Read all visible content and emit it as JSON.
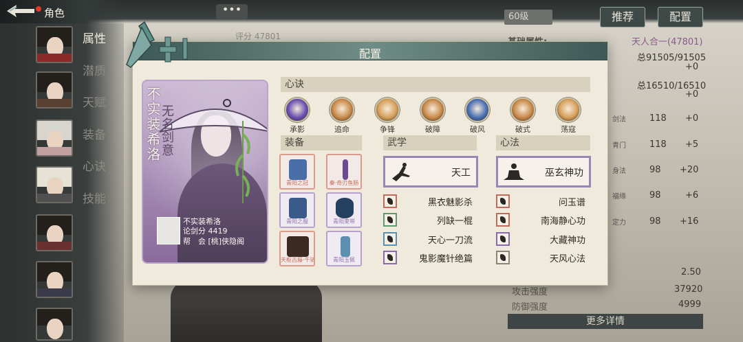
{
  "header": {
    "title": "角色"
  },
  "side_nav": [
    "属性",
    "潜质",
    "天赋",
    "装备",
    "心诀",
    "技能"
  ],
  "top": {
    "level": "60级",
    "score": "评分 47801",
    "recommend_label": "推荐",
    "config_label": "配置",
    "chat_label": "•••"
  },
  "right_panel": {
    "basic_attr_label": "基础属性:",
    "realm": "天人合一(47801)",
    "total1": "总91505/91505",
    "plus1": "+0",
    "total2": "总16510/16510",
    "plus2": "+0",
    "stats": [
      {
        "name": "剑法",
        "value": "118",
        "bonus": "+0"
      },
      {
        "name": "青门",
        "value": "118",
        "bonus": "+5"
      },
      {
        "name": "身法",
        "value": "98",
        "bonus": "+20"
      },
      {
        "name": "福缘",
        "value": "98",
        "bonus": "+6"
      },
      {
        "name": "定力",
        "value": "98",
        "bonus": "+16"
      }
    ],
    "crit_value": "2.50",
    "attack_label": "攻击强度",
    "attack_value": "37920",
    "defense_label": "防御强度",
    "defense_value": "4999",
    "more_label": "更多详情"
  },
  "modal": {
    "title": "配置",
    "character": {
      "name": "不实装希洛",
      "title": "无名剑意",
      "info_name": "不实装希洛",
      "info_score": "论剑分 4419",
      "info_guild": "帮　会 [桃]侠隐阁"
    },
    "xinjue_label": "心诀",
    "xinjue": [
      {
        "label": "承影",
        "color": "#6a4fb3"
      },
      {
        "label": "追命",
        "color": "#c98a4a"
      },
      {
        "label": "争锋",
        "color": "#d6a05a"
      },
      {
        "label": "破障",
        "color": "#c98a4a"
      },
      {
        "label": "破风",
        "color": "#4a6fb3"
      },
      {
        "label": "破式",
        "color": "#c98a4a"
      },
      {
        "label": "荡寇",
        "color": "#d6a05a"
      }
    ],
    "equipment_label": "装备",
    "equipment": [
      {
        "name": "青阳之冠",
        "style": "red",
        "color": "#4a6fa8"
      },
      {
        "name": "秦·奇刃鱼肠",
        "style": "red",
        "color": "#6a4b8f"
      },
      {
        "name": "青阳之服",
        "style": "purple",
        "color": "#3a5a8a"
      },
      {
        "name": "青阳束带",
        "style": "purple",
        "color": "#26405f"
      },
      {
        "name": "天枢古藤·千骑",
        "style": "red",
        "color": "#3a2a22"
      },
      {
        "name": "青阳玉佩",
        "style": "purple",
        "color": "#5d8fb0"
      }
    ],
    "martial_label": "武学",
    "martial_main": "天工",
    "martial_list": [
      {
        "name": "黑衣魅影杀",
        "border": "red"
      },
      {
        "name": "列缺一棍",
        "border": "green"
      },
      {
        "name": "天心一刀流",
        "border": "blue"
      },
      {
        "name": "鬼影魔针绝篇",
        "border": "purple"
      }
    ],
    "method_label": "心法",
    "method_main": "巫玄神功",
    "method_list": [
      {
        "name": "问玉谱",
        "border": "red"
      },
      {
        "name": "南海静心功",
        "border": "red"
      },
      {
        "name": "大藏神功",
        "border": "purple"
      },
      {
        "name": "天风心法",
        "border": "grey"
      }
    ]
  }
}
